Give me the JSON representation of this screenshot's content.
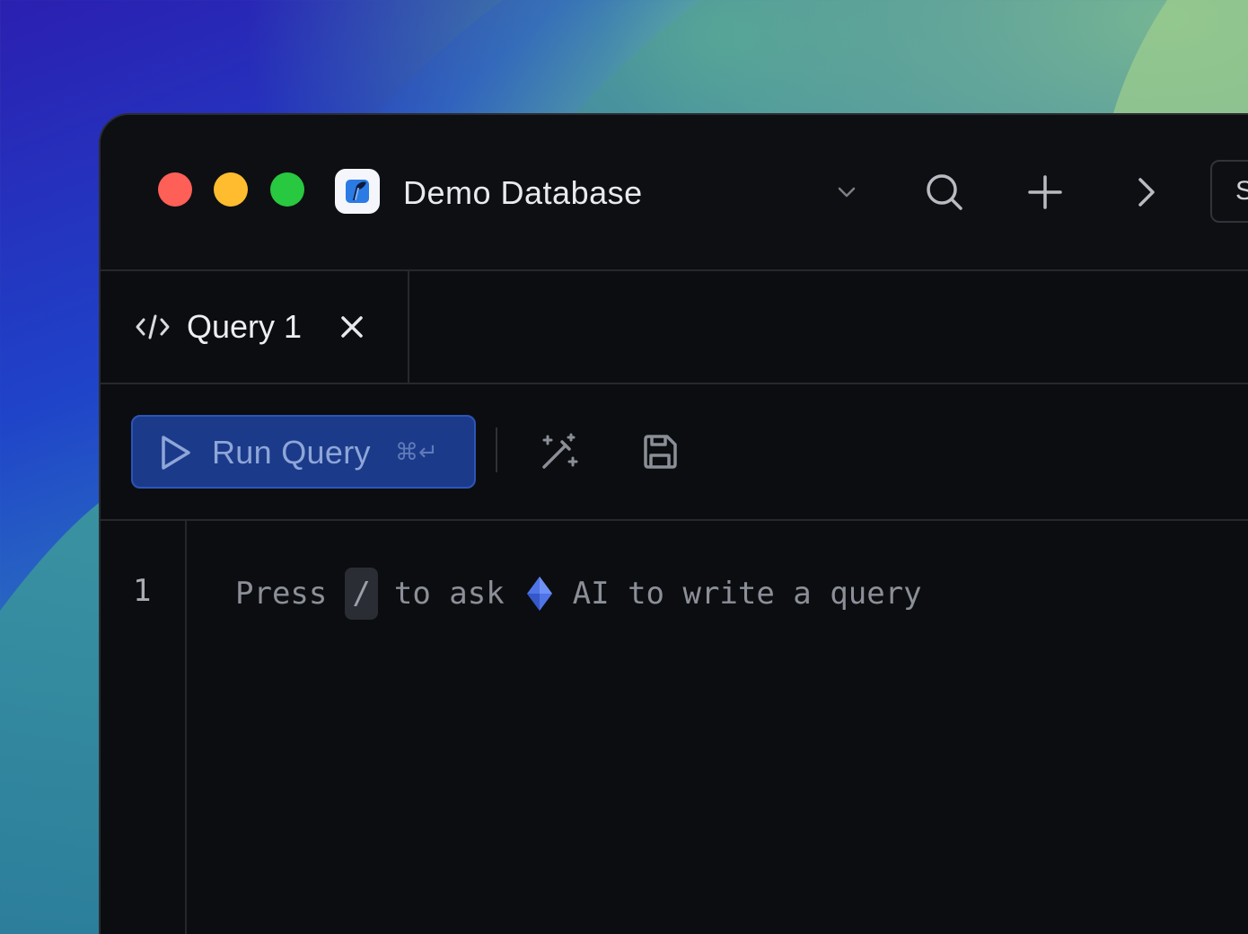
{
  "window": {
    "title": "Demo Database",
    "side_button_label": "S"
  },
  "tabs": [
    {
      "label": "Query 1",
      "icon": "code-icon",
      "active": true
    }
  ],
  "toolbar": {
    "run_label": "Run Query",
    "run_shortcut": "⌘↵"
  },
  "editor": {
    "line_number": "1",
    "placeholder_before": "Press",
    "placeholder_key": "/",
    "placeholder_mid": "to ask",
    "placeholder_after": "AI to write a query"
  },
  "colors": {
    "run_button_bg": "#1b3a8a",
    "ai_diamond": "#4f74e8",
    "traffic_red": "#fe5f57",
    "traffic_yellow": "#febc2e",
    "traffic_green": "#28c840"
  }
}
